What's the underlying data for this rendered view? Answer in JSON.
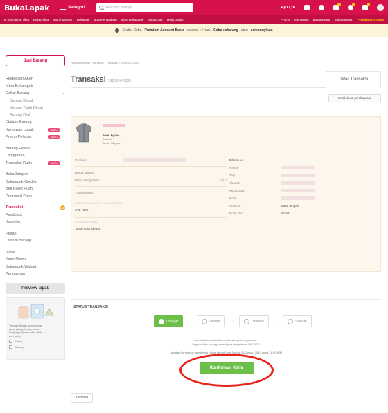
{
  "header": {
    "logo": "BukaLapak",
    "kategori_label": "Kategori",
    "search_placeholder": "Aku mau belanja...",
    "balance": "Rp17,rb"
  },
  "subnav": {
    "left_items": [
      "E-Voucher & Tiket",
      "BukaReksa",
      "Mobil & Motor",
      "BukaMall",
      "BukaPengadaan",
      "Mitra Bukalapak",
      "BukaEmas",
      "Mulai Jualan"
    ],
    "right_items": [
      "Promo",
      "Komunitas",
      "BukaReview",
      "BukaBantuan"
    ],
    "premium_label": "Premium Account"
  },
  "notice": {
    "prefix": "Gratis! Coba",
    "highlight": "Premium Account Basic",
    "middle": "selama 14 hari.",
    "cta": "Coba sekarang",
    "suffix": "atau",
    "dismiss": "sembunyikan"
  },
  "sidebar": {
    "jual_button": "Jual Barang",
    "items": [
      {
        "label": "Ringkasan Akun"
      },
      {
        "label": "Mitra Bukalapak"
      },
      {
        "label": "Daftar Barang"
      },
      {
        "label": "Barang Dijual"
      },
      {
        "label": "Barang Tidak Dijual"
      },
      {
        "label": "Barang Draf"
      },
      {
        "label": "Etalase Barang"
      },
      {
        "label": "Karyawan Lapak",
        "badge": "BARU"
      },
      {
        "label": "Promo Pelapak",
        "badge": "BARU"
      },
      {
        "label": "Barang Favorit"
      },
      {
        "label": "Langganan"
      },
      {
        "label": "Transaksi Rutin",
        "badge": "BARU"
      },
      {
        "label": "BukaDompet"
      },
      {
        "label": "Bukalapak Credits"
      },
      {
        "label": "Beli Paket Push"
      },
      {
        "label": "Promoted Push"
      },
      {
        "label": "Transaksi",
        "count": "20"
      },
      {
        "label": "Feedback"
      },
      {
        "label": "Komplain"
      },
      {
        "label": "Pesan"
      },
      {
        "label": "Diskusi Barang"
      },
      {
        "label": "Invite"
      },
      {
        "label": "Kode Promo"
      },
      {
        "label": "Bukalapak Widget"
      },
      {
        "label": "Pengaturan"
      }
    ],
    "preview_button": "Preview lapak",
    "promo_text": "Tempat liburan seperti apa yang paling sering kamu kunjungi? (boleh pilih lebih dari satu)",
    "promo_options": [
      "Pantai",
      "Gunung"
    ]
  },
  "main": {
    "breadcrumb": "Halaman depan › Ha-lapak › Transaksi › 191020747539",
    "title": "Transaksi",
    "transaction_id": "191020747539",
    "detail_tab": "Detail Transaksi",
    "cetak_button": "Cetak bukti pembayaran",
    "product": {
      "price": "Total: Rp100",
      "qty": "Jumlah: 1",
      "weight": "Berat: 90 gram"
    },
    "left": {
      "pembeli": "Pembeli:",
      "harga_barang": "Harga Barang:",
      "biaya_pengiriman": "Biaya Pengiriman:",
      "biaya_value": "Rp 0",
      "total_belanja": "Total Belanja:",
      "kurir_heading": "JASA PENGIRIMAN PILIHAN PEMBELI",
      "kurir": "JNE REG",
      "catatan_heading": "CATATAN PEMBELI",
      "catatan": "\"good color please\""
    },
    "right": {
      "dikirim_ke": "Dikirim ke:",
      "nama": "Nama:",
      "telp": "Telp:",
      "alamat": "Alamat:",
      "kecamatan": "Kecamatan:",
      "kota": "Kota:",
      "provinsi": "Provinsi:",
      "provinsi_value": "Jawa Tengah",
      "kode_pos": "Kode Pos:",
      "kode_pos_value": "50267"
    },
    "status": {
      "title": "STATUS TRANSAKSI",
      "steps": [
        "Dibayar",
        "Dikirim",
        "Diterima",
        "Selesai"
      ],
      "line1": "Kamu telah melakukan konfirmasi proses pesanan.",
      "line2": "Segera kirim barang melalui jasa pengiriman JNE REG",
      "line3": "Lakukan konfirmasi pengiriman paling lambat hari Jum'at, 18 Januari 2019 pukul 18:09 WIB",
      "confirm_button": "Konfirmasi Kirim"
    },
    "back_button": "Kembali"
  }
}
